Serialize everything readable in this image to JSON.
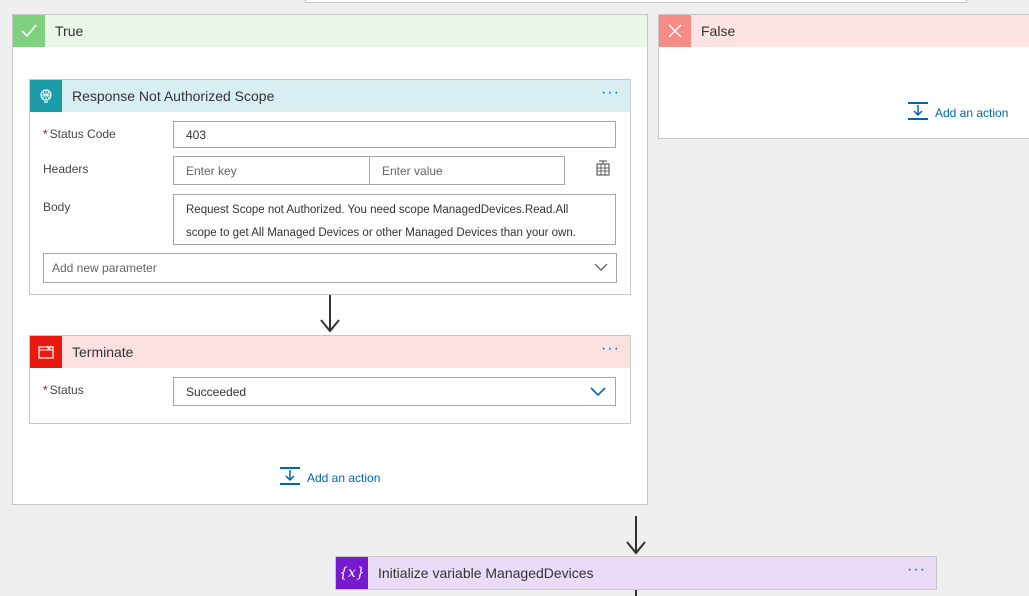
{
  "condition": {
    "true_label": "True",
    "false_label": "False",
    "add_action_label": "Add an action"
  },
  "response_action": {
    "title": "Response Not Authorized Scope",
    "more_label": "···",
    "status_code_label": "Status Code",
    "status_code_value": "403",
    "headers_label": "Headers",
    "header_key_placeholder": "Enter key",
    "header_value_placeholder": "Enter value",
    "body_label": "Body",
    "body_line1": "Request Scope not Authorized. You need scope ManagedDevices.Read.All",
    "body_line2": "scope to get All Managed Devices or other Managed Devices than your own.",
    "add_param_placeholder": "Add new parameter"
  },
  "terminate_action": {
    "title": "Terminate",
    "more_label": "···",
    "status_label": "Status",
    "status_value": "Succeeded"
  },
  "init_var_action": {
    "title": "Initialize variable ManagedDevices",
    "icon_text": "{x}",
    "more_label": "···"
  },
  "colors": {
    "accent_link": "#0066b3",
    "true_icon": "#7fd17f",
    "false_icon": "#f58c86",
    "response_icon": "#1a9ba7",
    "terminate_icon": "#e8190f",
    "variable_icon": "#7719d1"
  }
}
